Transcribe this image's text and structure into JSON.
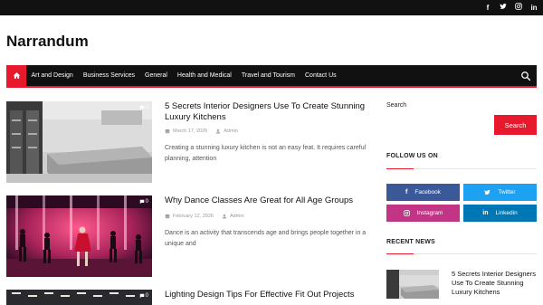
{
  "topbar": {
    "social": [
      {
        "icon": "facebook-icon",
        "glyph": "f"
      },
      {
        "icon": "twitter-icon",
        "glyph": "🐦"
      },
      {
        "icon": "instagram-icon",
        "glyph": "◎"
      },
      {
        "icon": "linkedin-icon",
        "glyph": "in"
      }
    ]
  },
  "site": {
    "title": "Narrandum"
  },
  "nav": {
    "home_icon": "home-icon",
    "items": [
      "Art and Design",
      "Business Services",
      "General",
      "Health and Medical",
      "Travel and Tourism",
      "Contact Us"
    ],
    "search_icon": "search-icon"
  },
  "posts": [
    {
      "title": "5 Secrets Interior Designers Use To Create Stunning Luxury Kitchens",
      "date": "March 17, 2026",
      "author": "Admin",
      "excerpt": "Creating a stunning luxury kitchen is not an easy feat. It requires careful planning, attention",
      "comments": "0"
    },
    {
      "title": "Why Dance Classes Are Great for All Age Groups",
      "date": "February 12, 2026",
      "author": "Admin",
      "excerpt": "Dance is an activity that transcends age and brings people together in a unique and",
      "comments": "0"
    },
    {
      "title": "Lighting Design Tips For Effective Fit Out Projects",
      "comments": "0"
    }
  ],
  "sidebar": {
    "search_label": "Search",
    "search_placeholder": "",
    "search_button": "Search",
    "follow_title": "FOLLOW US ON",
    "follow_buttons": [
      {
        "label": "Facebook",
        "color": "#3b5998",
        "icon": "facebook-icon",
        "glyph": "f"
      },
      {
        "label": "Twitter",
        "color": "#1da1f2",
        "icon": "twitter-icon",
        "glyph": "🐦"
      },
      {
        "label": "Instagram",
        "color": "#c13584",
        "icon": "instagram-icon",
        "glyph": "◎"
      },
      {
        "label": "Linkedin",
        "color": "#0077b5",
        "icon": "linkedin-icon",
        "glyph": "in"
      }
    ],
    "recent_title": "RECENT NEWS",
    "recent_post_title": "5 Secrets Interior Designers Use To Create Stunning Luxury Kitchens"
  },
  "colors": {
    "accent": "#e8192c",
    "dark": "#111111"
  }
}
